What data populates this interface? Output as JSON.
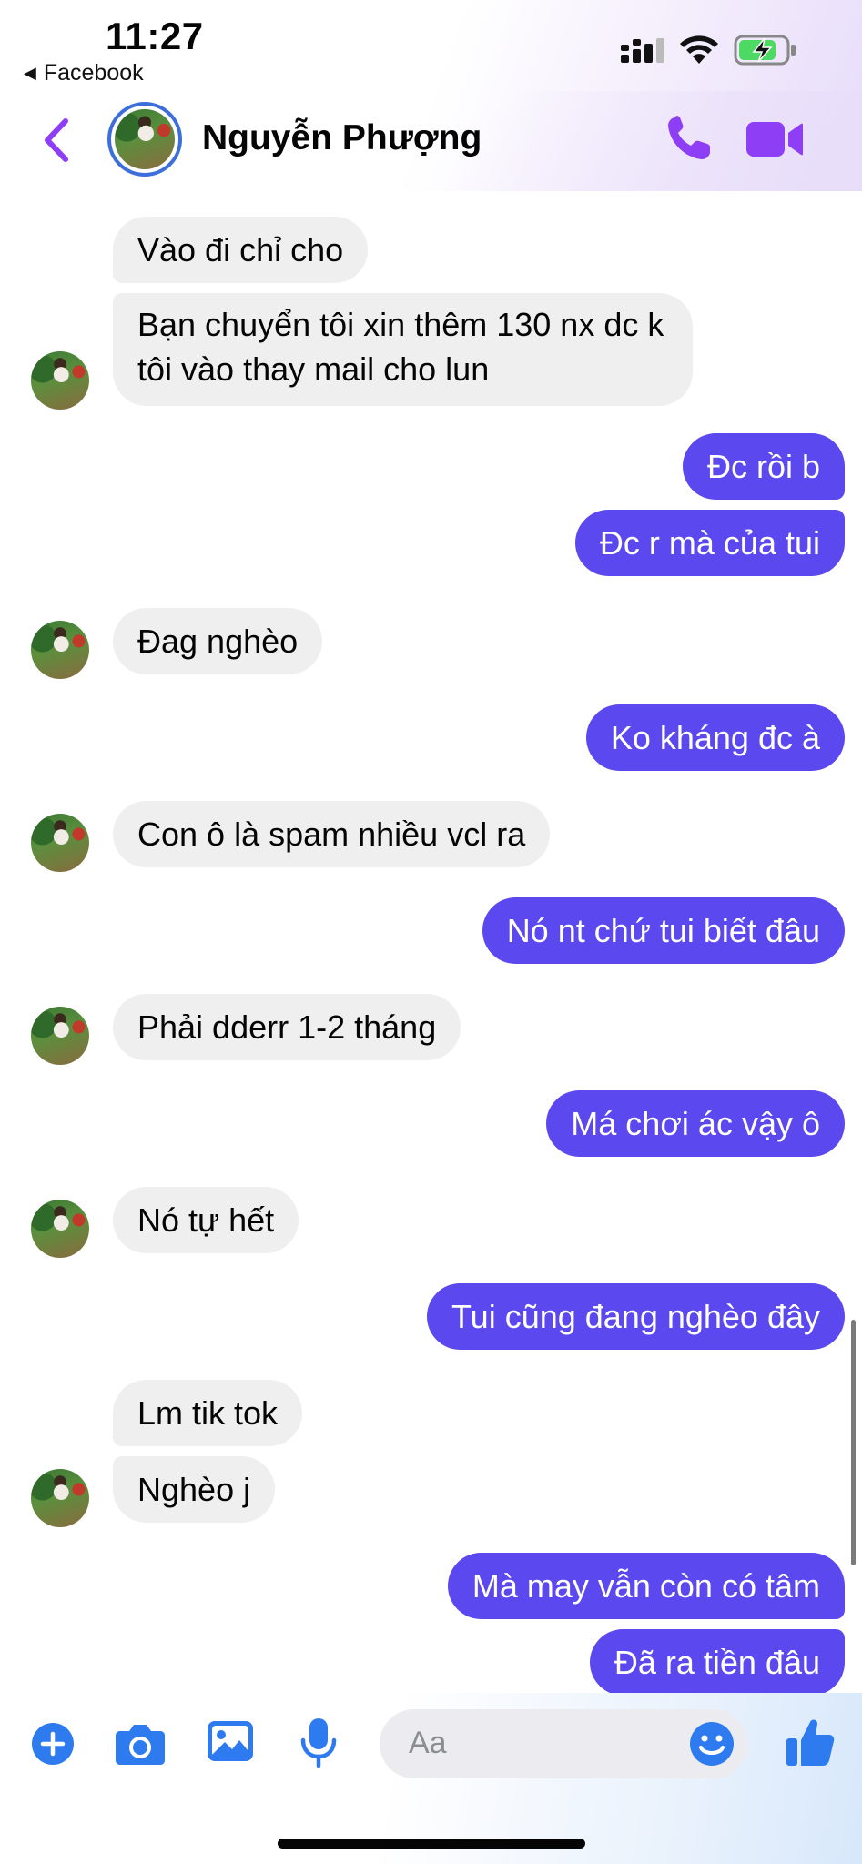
{
  "status_bar": {
    "time": "11:27",
    "back_app": "Facebook",
    "back_icon": "small-left-triangle-icon",
    "icons": [
      "cellular-signal-icon",
      "wifi-icon",
      "battery-charging-icon"
    ],
    "battery_color": "#4cd964"
  },
  "header": {
    "contact_name": "Nguyễn Phượng",
    "icons": [
      "back-chevron-icon",
      "phone-call-icon",
      "video-call-icon"
    ],
    "accent_color": "#8e3ff5"
  },
  "messages": [
    {
      "side": "in",
      "text": "Vào đi chỉ cho"
    },
    {
      "side": "in",
      "lines": [
        "Bạn chuyển tôi xin thêm 130 nx dc k",
        "tôi vào thay mail cho lun"
      ]
    },
    {
      "side": "out",
      "text": "Đc rồi b"
    },
    {
      "side": "out",
      "text": "Đc r mà của tui"
    },
    {
      "side": "in",
      "text": "Đag nghèo"
    },
    {
      "side": "out",
      "text": "Ko kháng đc à"
    },
    {
      "side": "in",
      "text": "Con ô là spam nhiều vcl ra"
    },
    {
      "side": "out",
      "text": "Nó nt chứ tui biết đâu"
    },
    {
      "side": "in",
      "text": "Phải dderr 1-2 tháng"
    },
    {
      "side": "out",
      "text": "Má chơi ác vậy ô"
    },
    {
      "side": "in",
      "text": "Nó tự hết"
    },
    {
      "side": "out",
      "text": "Tui cũng đang nghèo đây"
    },
    {
      "side": "in",
      "text": "Lm tik tok"
    },
    {
      "side": "in",
      "text": "Nghèo j"
    },
    {
      "side": "out",
      "text": "Mà may vẫn còn có tâm"
    },
    {
      "side": "out",
      "text": "Đã ra tiền đâu"
    }
  ],
  "composer": {
    "placeholder": "Aa",
    "icons": [
      "plus-icon",
      "camera-icon",
      "photo-icon",
      "microphone-icon",
      "emoji-icon",
      "thumbs-up-icon"
    ],
    "accent_color": "#2e7bf0"
  },
  "colors": {
    "outgoing_bubble": "#5b48ee",
    "incoming_bubble": "#efefef"
  }
}
